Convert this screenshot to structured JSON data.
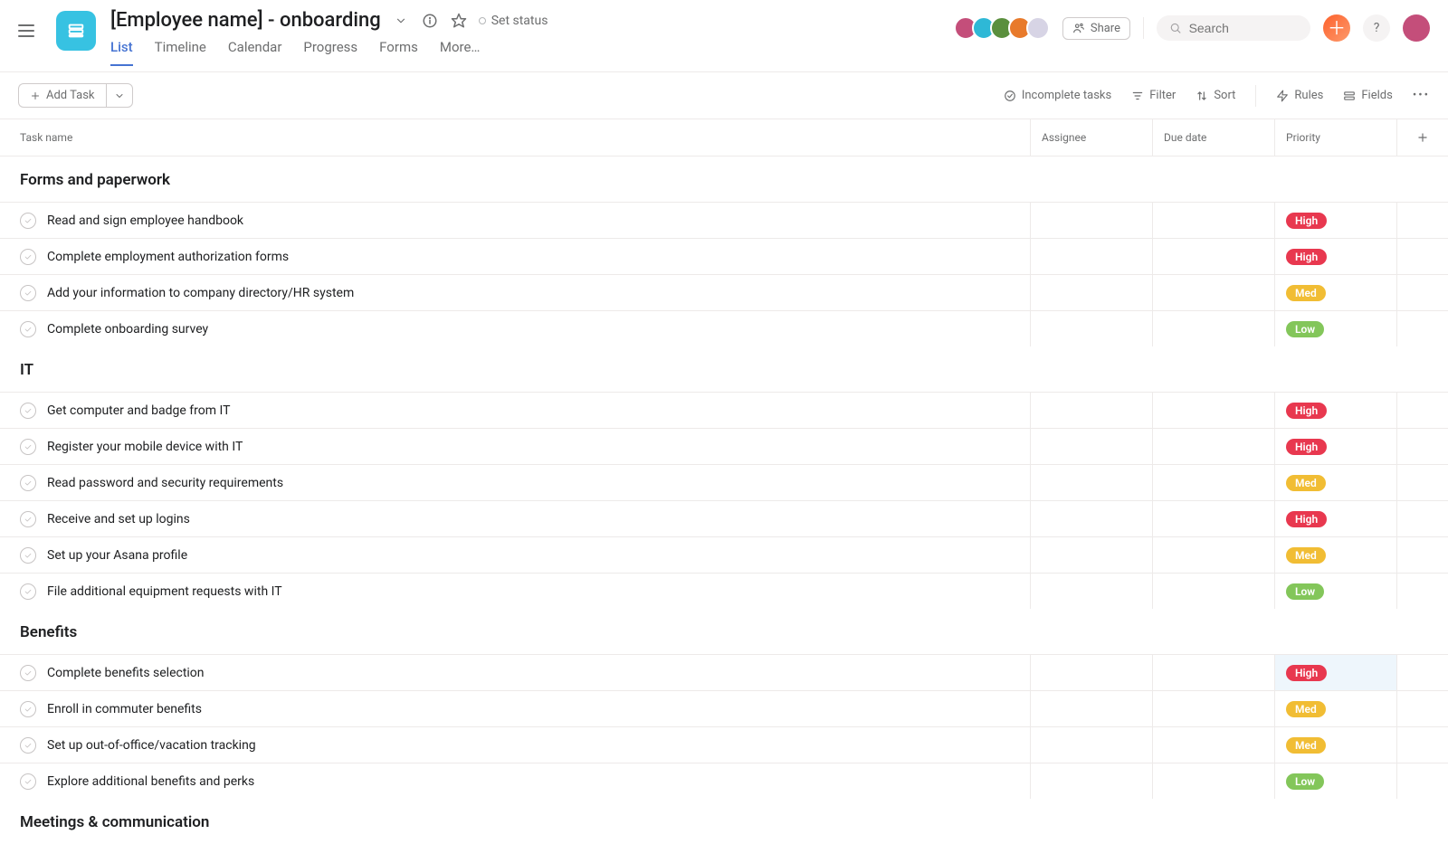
{
  "header": {
    "project_title": "[Employee name] - onboarding",
    "set_status_label": "Set status",
    "tabs": [
      "List",
      "Timeline",
      "Calendar",
      "Progress",
      "Forms",
      "More…"
    ],
    "active_tab_index": 0,
    "share_label": "Share",
    "search_placeholder": "Search",
    "help_label": "?",
    "avatars": [
      {
        "color": "#c44e7a"
      },
      {
        "color": "#2eb8d6"
      },
      {
        "color": "#5a8f3d"
      },
      {
        "color": "#e87a2b"
      },
      {
        "color": "#d7d4e5"
      }
    ],
    "user_avatar_color": "#c44e7a"
  },
  "toolbar": {
    "add_task_label": "Add Task",
    "incomplete_label": "Incomplete tasks",
    "filter_label": "Filter",
    "sort_label": "Sort",
    "rules_label": "Rules",
    "fields_label": "Fields"
  },
  "columns": {
    "task": "Task name",
    "assignee": "Assignee",
    "due": "Due date",
    "priority": "Priority"
  },
  "sections": [
    {
      "title": "Forms and paperwork",
      "tasks": [
        {
          "name": "Read and sign employee handbook",
          "priority": "High"
        },
        {
          "name": "Complete employment authorization forms",
          "priority": "High"
        },
        {
          "name": "Add your information to company directory/HR system",
          "priority": "Med"
        },
        {
          "name": "Complete onboarding survey",
          "priority": "Low"
        }
      ]
    },
    {
      "title": "IT",
      "tasks": [
        {
          "name": "Get computer and badge from IT",
          "priority": "High"
        },
        {
          "name": "Register your mobile device with IT",
          "priority": "High"
        },
        {
          "name": "Read password and security requirements",
          "priority": "Med"
        },
        {
          "name": "Receive and set up logins",
          "priority": "High"
        },
        {
          "name": "Set up your Asana profile",
          "priority": "Med"
        },
        {
          "name": "File additional equipment requests with IT",
          "priority": "Low"
        }
      ]
    },
    {
      "title": "Benefits",
      "tasks": [
        {
          "name": "Complete benefits selection",
          "priority": "High",
          "highlight": true
        },
        {
          "name": "Enroll in commuter benefits",
          "priority": "Med"
        },
        {
          "name": "Set up out-of-office/vacation tracking",
          "priority": "Med"
        },
        {
          "name": "Explore additional benefits and perks",
          "priority": "Low"
        }
      ]
    },
    {
      "title": "Meetings & communication",
      "tasks": []
    }
  ]
}
